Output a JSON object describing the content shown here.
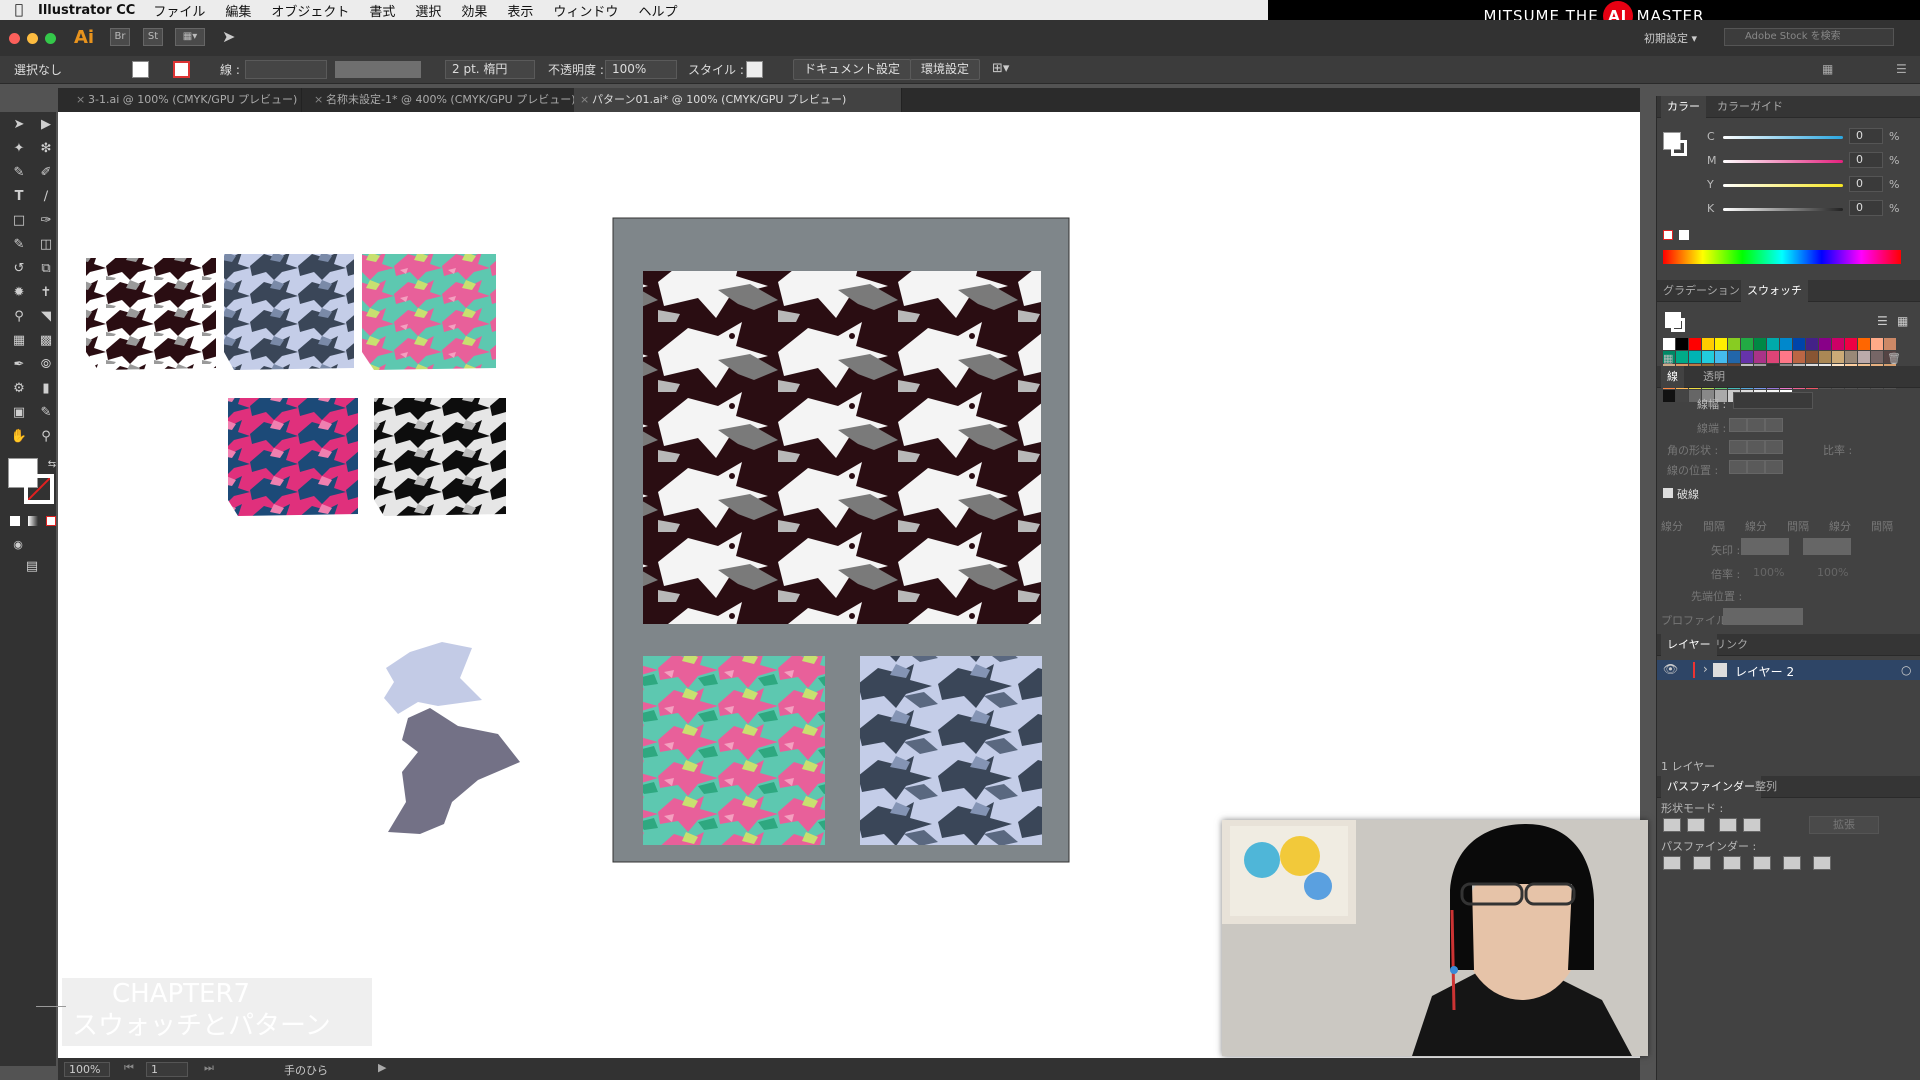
{
  "menubar": {
    "app_name": "Illustrator CC",
    "items": [
      "ファイル",
      "編集",
      "オブジェクト",
      "書式",
      "選択",
      "効果",
      "表示",
      "ウィンドウ",
      "ヘルプ"
    ]
  },
  "brand": {
    "left": "MITSUME THE",
    "logo": "AI",
    "right": "MASTER"
  },
  "appbar": {
    "logo": "Ai",
    "st_label": "St",
    "workspace": "初期設定",
    "search_placeholder": "Adobe Stock を検索"
  },
  "control": {
    "selection": "選択なし",
    "stroke_label": "線 :",
    "brush": "2 pt. 楕円",
    "opacity_label": "不透明度 :",
    "opacity_value": "100%",
    "style_label": "スタイル :",
    "doc_settings": "ドキュメント設定",
    "prefs": "環境設定"
  },
  "tabs": [
    {
      "label": "3-1.ai @ 100% (CMYK/GPU プレビュー)"
    },
    {
      "label": "名称未設定-1* @ 400% (CMYK/GPU プレビュー)"
    },
    {
      "label": "パターン01.ai* @ 100% (CMYK/GPU プレビュー)"
    }
  ],
  "status": {
    "zoom": "100%",
    "page": "1",
    "tool": "手のひら"
  },
  "chapter": {
    "line1": "CHAPTER7",
    "line2": "スウォッチとパターン"
  },
  "color_panel": {
    "tabs": [
      "カラー",
      "カラーガイド"
    ],
    "channels": [
      {
        "label": "C",
        "value": "0",
        "unit": "%",
        "color": "#2aa6e0"
      },
      {
        "label": "M",
        "value": "0",
        "unit": "%",
        "color": "#e4207d"
      },
      {
        "label": "Y",
        "value": "0",
        "unit": "%",
        "color": "#f6e620"
      },
      {
        "label": "K",
        "value": "0",
        "unit": "%",
        "color": "#222222"
      }
    ]
  },
  "swatch_panel": {
    "tabs": [
      "グラデーション",
      "スウォッチ"
    ],
    "rows": [
      [
        "#ffffff",
        "#000000",
        "#ff0000",
        "#ffcc00",
        "#ffee00",
        "#88cc22",
        "#22aa44",
        "#008844",
        "#00aaaa",
        "#0088cc",
        "#0044aa",
        "#442288",
        "#880088",
        "#cc0066",
        "#ee0044",
        "#ff6600",
        "#ffaa88",
        "#cc8866"
      ],
      [
        "#008866",
        "#00aa88",
        "#00b3b3",
        "#22ccdd",
        "#44bbee",
        "#2266aa",
        "#6633aa",
        "#aa3388",
        "#dd4477",
        "#ff7788",
        "#bb6644",
        "#885533",
        "#aa8855",
        "#ccaa77",
        "#998877",
        "#bbaaaa",
        "#776666",
        "#554444"
      ],
      [
        "#ccaa88",
        "#dd9966",
        "#bb7744",
        "#886633",
        "#775544",
        "#664433",
        "#c0c0c0",
        "#a0a0a0",
        "#333333",
        "#888888",
        "#bbbbbb",
        "#dddddd",
        "#e8e8e8",
        "#ffe4c4",
        "#ffd0a0",
        "#f0c090",
        "#e8b080",
        "#d8a070"
      ],
      [
        "#ff8844",
        "#ffbb55",
        "#eedd44",
        "#bbdd55",
        "#66cc77",
        "#44bbbb",
        "#55aadd",
        "#7799ee",
        "#9977dd",
        "#ee77cc",
        "#f06090",
        "#ee5566",
        "#555555",
        "#555555",
        "#555555",
        "#555555",
        "#555555",
        "#555555"
      ],
      [
        "#111111",
        "#444444",
        "#666666",
        "#888888",
        "#aaaaaa",
        "#cccccc",
        "#dddddd",
        "#eeeeee",
        "#f5f5f5",
        "#ffffff"
      ]
    ]
  },
  "stroke_panel": {
    "tabs": [
      "線",
      "透明"
    ],
    "weight_label": "線幅 :",
    "cap_label": "線端 :",
    "corner_label": "角の形状 :",
    "ratio_label": "比率 :",
    "align_label": "線の位置 :",
    "dashed_label": "破線",
    "dash_labels": [
      "線分",
      "間隔",
      "線分",
      "間隔",
      "線分",
      "間隔"
    ],
    "arrow_label": "矢印 :",
    "scale_label": "倍率 :",
    "scale_values": [
      "100%",
      "100%"
    ],
    "align_arrow_label": "先端位置 :",
    "profile_label": "プロファイル :"
  },
  "layer_panel": {
    "tabs": [
      "レイヤー",
      "リンク"
    ],
    "layer_name": "レイヤー 2",
    "count": "1 レイヤー"
  },
  "pathfinder_panel": {
    "tabs": [
      "パスファインダー",
      "整列"
    ],
    "shape_modes": "形状モード :",
    "expand": "拡張",
    "pathfinders": "パスファインダー :"
  },
  "colors": {
    "accent": "#e60012",
    "ai_orange": "#e8931d",
    "panel": "#424242"
  }
}
